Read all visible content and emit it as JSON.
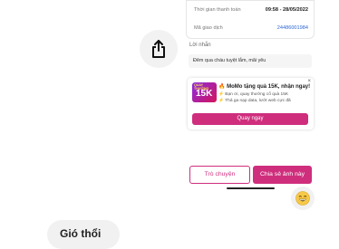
{
  "transaction": {
    "time_label": "Thời gian thanh toán",
    "time_value": "09:58 - 28/05/2022",
    "id_label": "Mã giao dịch",
    "id_value": "24486001984"
  },
  "message": {
    "label": "Lời nhắn",
    "text": "Đêm qua cháu tuyệt lắm, mãi yêu"
  },
  "promo": {
    "badge_line1": "QUAY THƯỞNG",
    "badge_amount": "15K",
    "title": "🔥 MoMo tặng quà 15K, nhận ngay!",
    "bullet1": "⚡ Bạn ơi, quay thưởng cổ quà 15K",
    "bullet2": "⚡ Thả ga nạp data, lướt web cực đã",
    "cta": "Quay ngay",
    "close": "×"
  },
  "actions": {
    "chat": "Trò chuyện",
    "share": "Chia sẻ ảnh này"
  },
  "bottom_pill": "Gió thổi",
  "colors": {
    "accent": "#cf2e7d",
    "link": "#2c67d6"
  },
  "icons": {
    "share": "share-icon",
    "emoji": "grinning-face-icon"
  }
}
